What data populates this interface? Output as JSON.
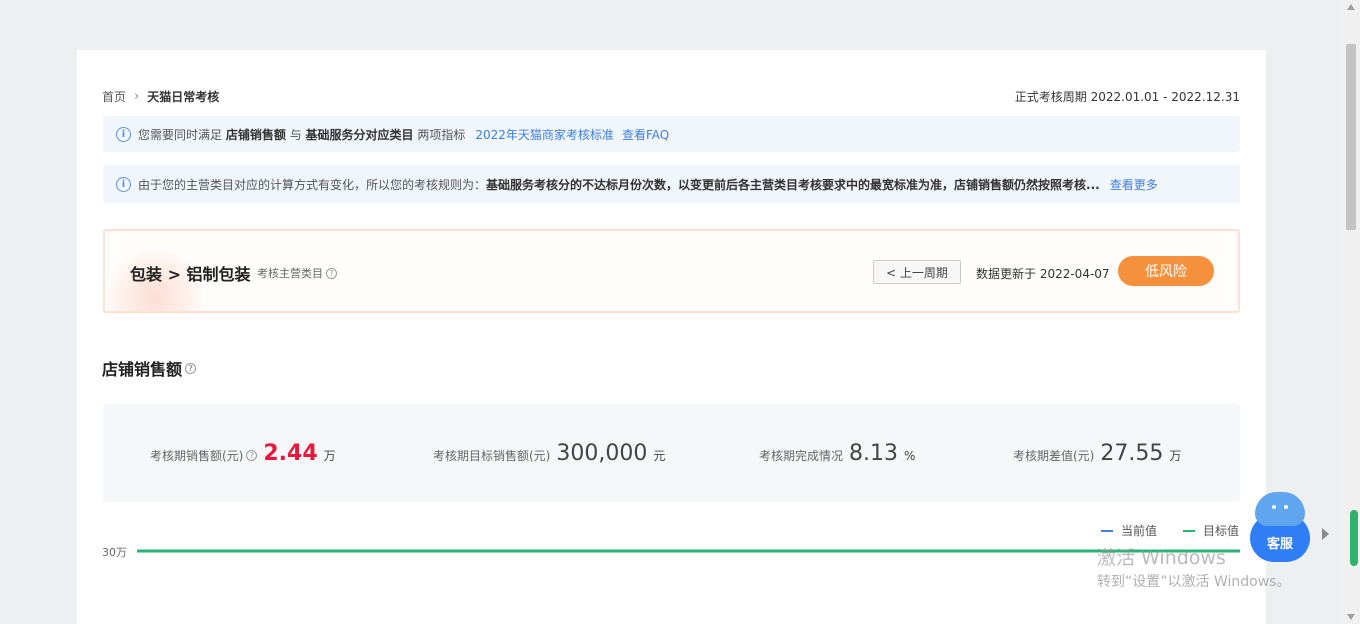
{
  "breadcrumb": {
    "home": "首页",
    "separator": "›",
    "current": "天猫日常考核"
  },
  "period": "正式考核周期 2022.01.01 - 2022.12.31",
  "notices": {
    "n1": {
      "prefix": "您需要同时满足",
      "bold1": "店铺销售额",
      "mid": "与",
      "bold2": "基础服务分对应类目",
      "suffix": "两项指标",
      "link1": "2022年天猫商家考核标准",
      "link2": "查看FAQ"
    },
    "n2": {
      "prefix": "由于您的主营类目对应的计算方式有变化，所以您的考核规则为：",
      "bold": "基础服务考核分的不达标月份次数，以变更前后各主营类目考核要求中的最宽标准为准，店铺销售额仍然按照考核...",
      "link": "查看更多"
    }
  },
  "category": {
    "title": "包装 > 铝制包装",
    "subtitle": "考核主营类目",
    "prev_button": "< 上一周期",
    "update_text": "数据更新于 2022-04-07",
    "risk": "低风险"
  },
  "section": {
    "title": "店铺销售额"
  },
  "metrics": {
    "m1": {
      "label": "考核期销售额(元)",
      "value": "2.44",
      "unit": "万"
    },
    "m2": {
      "label": "考核期目标销售额(元)",
      "value": "300,000",
      "unit": "元"
    },
    "m3": {
      "label": "考核期完成情况",
      "value": "8.13",
      "unit": "%"
    },
    "m4": {
      "label": "考核期差值(元)",
      "value": "27.55",
      "unit": "万"
    }
  },
  "legend": {
    "current": "当前值",
    "target": "目标值",
    "current_color": "#4a7fd8",
    "target_color": "#27b577"
  },
  "chart_data": {
    "type": "line",
    "ytick_label": "30万",
    "series": [
      {
        "name": "当前值",
        "values": []
      },
      {
        "name": "目标值",
        "values": [
          300000,
          300000
        ]
      }
    ]
  },
  "watermark": {
    "line1": "激活 Windows",
    "line2": "转到“设置”以激活 Windows。"
  },
  "service": {
    "label": "客服"
  },
  "icons": [
    "info-icon",
    "help-icon",
    "elephant-icon",
    "arrow-right-icon"
  ]
}
